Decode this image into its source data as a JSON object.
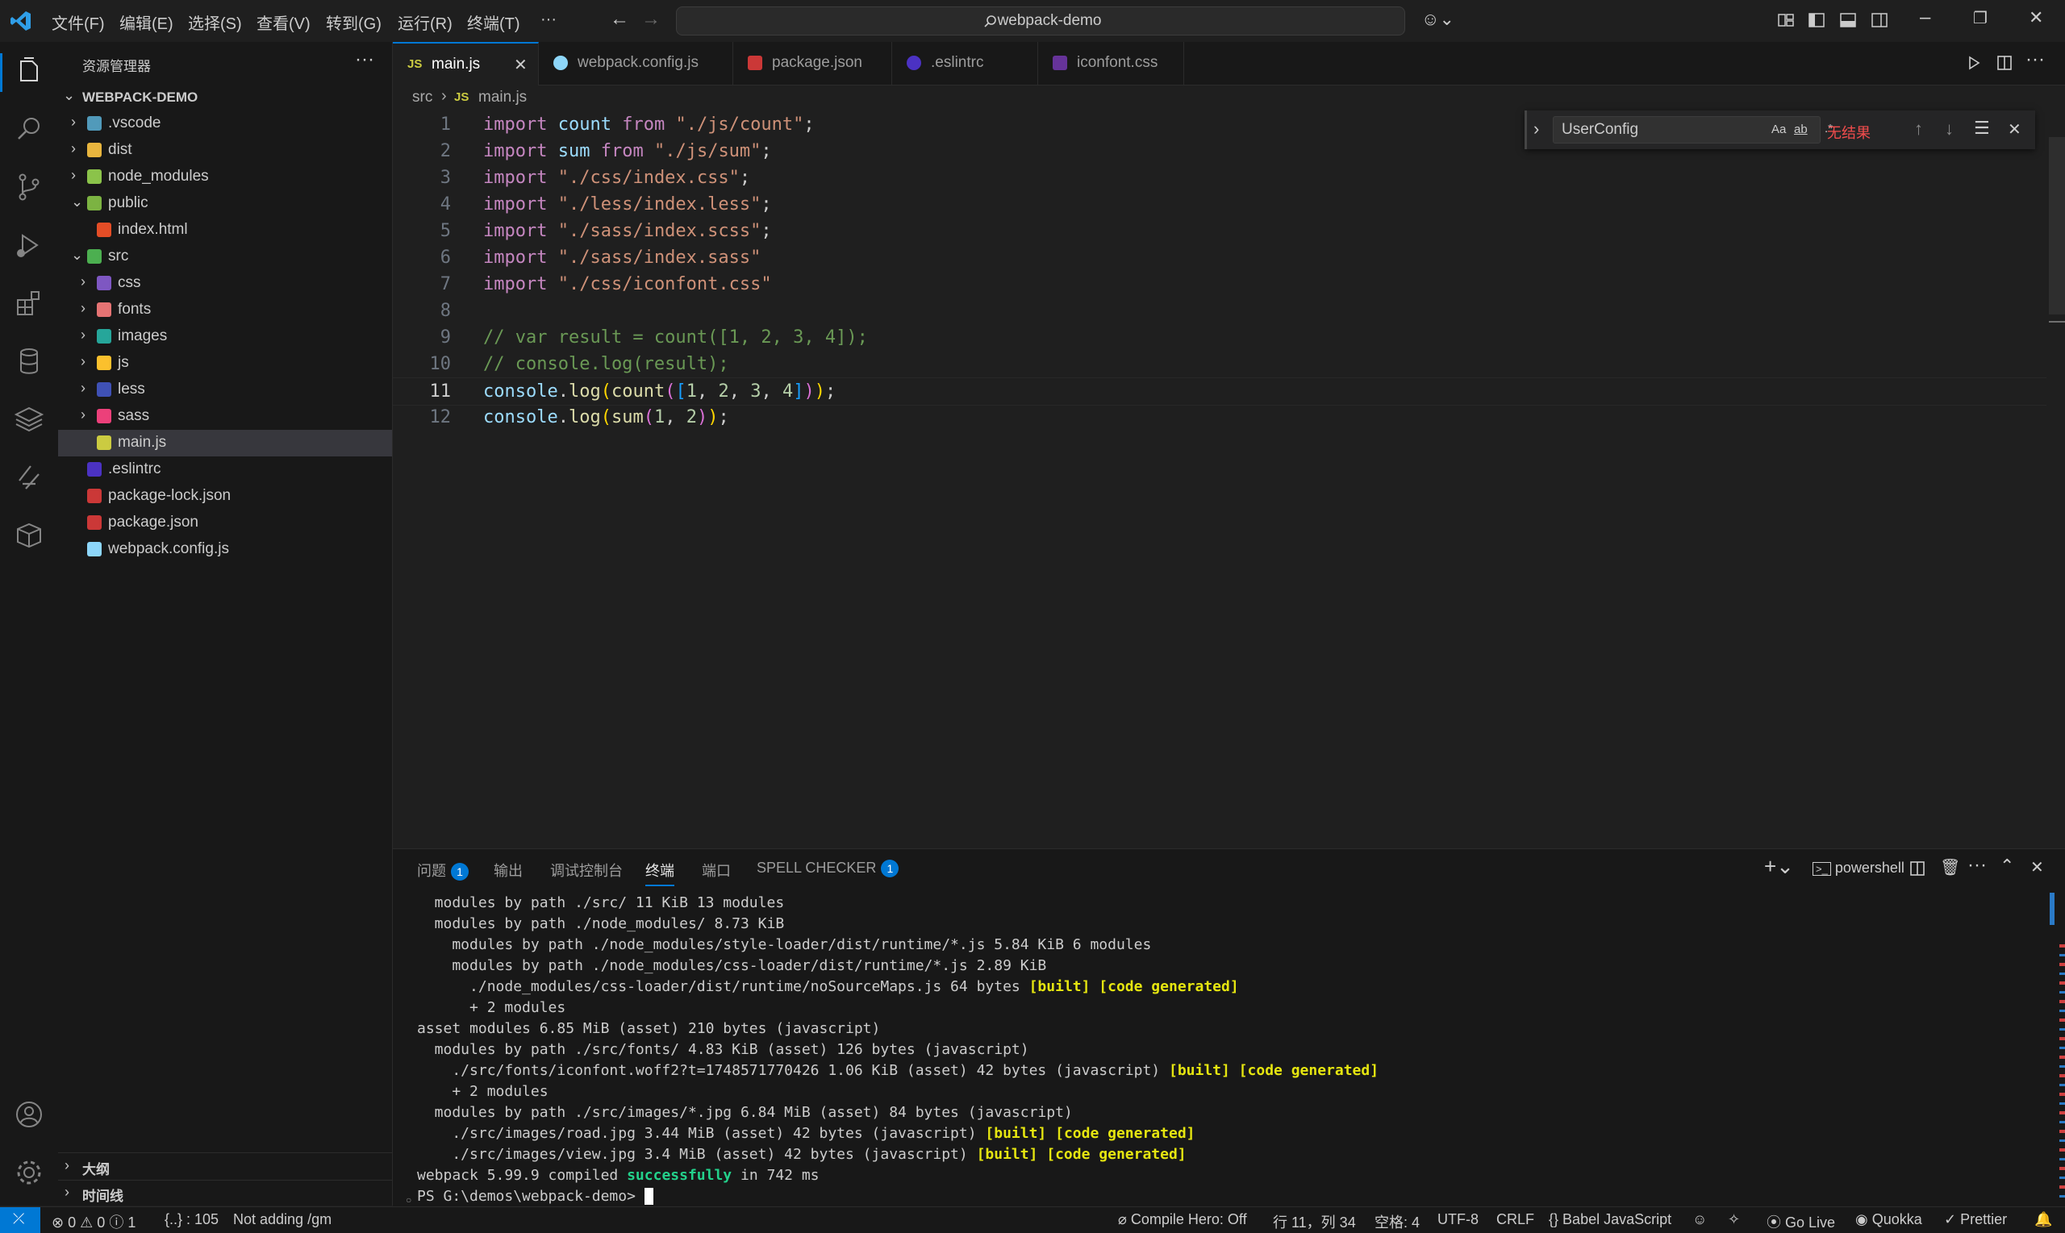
{
  "menu": [
    "文件(F)",
    "编辑(E)",
    "选择(S)",
    "查看(V)",
    "转到(G)",
    "运行(R)",
    "终端(T)",
    "···"
  ],
  "title_search": "webpack-demo",
  "sidebar": {
    "title": "资源管理器",
    "project": "WEBPACK-DEMO",
    "items": [
      {
        "label": ".vscode",
        "chev": "›",
        "color": "#519aba"
      },
      {
        "label": "dist",
        "chev": "›",
        "color": "#e8b53e"
      },
      {
        "label": "node_modules",
        "chev": "›",
        "color": "#8bc34a"
      },
      {
        "label": "public",
        "chev": "⌄",
        "color": "#7cb342"
      },
      {
        "label": "index.html",
        "chev": "",
        "color": "#e44d26"
      },
      {
        "label": "src",
        "chev": "⌄",
        "color": "#4caf50"
      },
      {
        "label": "css",
        "chev": "›",
        "color": "#7e57c2"
      },
      {
        "label": "fonts",
        "chev": "›",
        "color": "#e57373"
      },
      {
        "label": "images",
        "chev": "›",
        "color": "#26a69a"
      },
      {
        "label": "js",
        "chev": "›",
        "color": "#fbc02d"
      },
      {
        "label": "less",
        "chev": "›",
        "color": "#3f51b5"
      },
      {
        "label": "sass",
        "chev": "›",
        "color": "#ec407a"
      },
      {
        "label": "main.js",
        "chev": "",
        "color": "#cbcb41"
      },
      {
        "label": ".eslintrc",
        "chev": "",
        "color": "#4b32c3"
      },
      {
        "label": "package-lock.json",
        "chev": "",
        "color": "#cb3837"
      },
      {
        "label": "package.json",
        "chev": "",
        "color": "#cb3837"
      },
      {
        "label": "webpack.config.js",
        "chev": "",
        "color": "#8dd6f9"
      }
    ],
    "outline": "大纲",
    "timeline": "时间线"
  },
  "tabs": [
    "main.js",
    "webpack.config.js",
    "package.json",
    ".eslintrc",
    "iconfont.css"
  ],
  "breadcrumb": {
    "folder": "src",
    "file": "main.js"
  },
  "code": {
    "line_numbers": [
      "1",
      "2",
      "3",
      "4",
      "5",
      "6",
      "7",
      "8",
      "9",
      "10",
      "11",
      "12"
    ],
    "l1": {
      "kw": "import",
      "var": "count",
      "from": "from",
      "str": "\"./js/count\"",
      "end": ";"
    },
    "l2": {
      "kw": "import",
      "var": "sum",
      "from": "from",
      "str": "\"./js/sum\"",
      "end": ";"
    },
    "l3": {
      "kw": "import",
      "str": "\"./css/index.css\"",
      "end": ";"
    },
    "l4": {
      "kw": "import",
      "str": "\"./less/index.less\"",
      "end": ";"
    },
    "l5": {
      "kw": "import",
      "str": "\"./sass/index.scss\"",
      "end": ";"
    },
    "l6": {
      "kw": "import",
      "str": "\"./sass/index.sass\""
    },
    "l7": {
      "kw": "import",
      "str": "\"./css/iconfont.css\""
    },
    "l9": "// var result = count([1, 2, 3, 4]);",
    "l10": "// console.log(result);",
    "l11": {
      "obj": "console",
      "dot": ".",
      "fn": "log",
      "fn2": "count",
      "n1": "1",
      "n2": "2",
      "n3": "3",
      "n4": "4",
      "end": ";"
    },
    "l12": {
      "obj": "console",
      "dot": ".",
      "fn": "log",
      "fn2": "sum",
      "n1": "1",
      "n2": "2",
      "end": ";"
    }
  },
  "find": {
    "value": "UserConfig",
    "case": "Aa",
    "word": "ab",
    "regex": ".*",
    "result": "无结果"
  },
  "panel": {
    "tabs": {
      "problems": "问题",
      "problems_count": "1",
      "output": "输出",
      "debug": "调试控制台",
      "terminal": "终端",
      "ports": "端口",
      "spell": "SPELL CHECKER",
      "spell_count": "1"
    },
    "shell": "powershell"
  },
  "terminal": [
    "  modules by path ./src/ 11 KiB 13 modules",
    "  modules by path ./node_modules/ 8.73 KiB",
    "    modules by path ./node_modules/style-loader/dist/runtime/*.js 5.84 KiB 6 modules",
    "    modules by path ./node_modules/css-loader/dist/runtime/*.js 2.89 KiB",
    "      ./node_modules/css-loader/dist/runtime/noSourceMaps.js 64 bytes ",
    "      + 2 modules",
    "asset modules 6.85 MiB (asset) 210 bytes (javascript)",
    "  modules by path ./src/fonts/ 4.83 KiB (asset) 126 bytes (javascript)",
    "    ./src/fonts/iconfont.woff2?t=1748571770426 1.06 KiB (asset) 42 bytes (javascript) ",
    "    + 2 modules",
    "  modules by path ./src/images/*.jpg 6.84 MiB (asset) 84 bytes (javascript)",
    "    ./src/images/road.jpg 3.44 MiB (asset) 42 bytes (javascript) ",
    "    ./src/images/view.jpg 3.4 MiB (asset) 42 bytes (javascript) ",
    "webpack 5.99.9 compiled ",
    "PS G:\\demos\\webpack-demo> "
  ],
  "terminal_flags": {
    "built": "[built] [code generated]",
    "success": "successfully",
    "ms": " in 742 ms"
  },
  "status": {
    "errors": "0",
    "warnings": "0",
    "info": "1",
    "selection": "{..} : 105",
    "regex_note": "Not adding /gm",
    "compile_hero": "Compile Hero: Off",
    "position": "行 11，列 34",
    "spaces": "空格: 4",
    "encoding": "UTF-8",
    "eol": "CRLF",
    "language": "Babel JavaScript",
    "golive": "Go Live",
    "quokka": "Quokka",
    "prettier": "Prettier"
  }
}
